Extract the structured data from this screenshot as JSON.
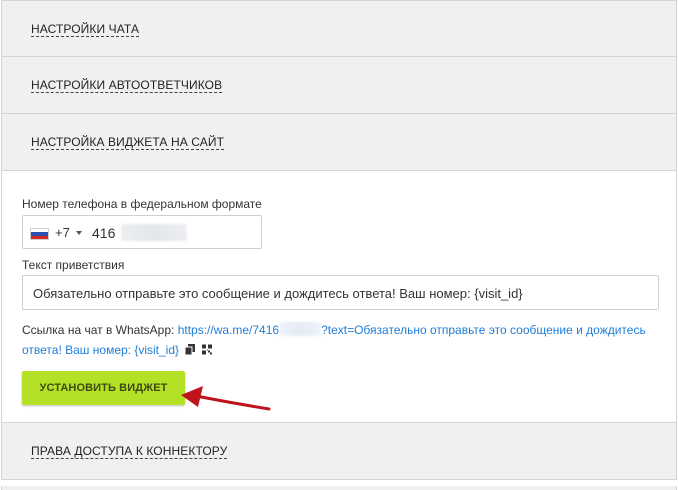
{
  "sections": {
    "chat_settings": "НАСТРОЙКИ ЧАТА",
    "autoresponder_settings": "НАСТРОЙКИ АВТООТВЕТЧИКОВ",
    "widget_settings": "НАСТРОЙКА ВИДЖЕТА НА САЙТ",
    "connector_access": "ПРАВА ДОСТУПА К КОННЕКТОРУ"
  },
  "widget": {
    "phone_label": "Номер телефона в федеральном формате",
    "country_code": "+7",
    "phone_value": "416",
    "greeting_label": "Текст приветствия",
    "greeting_value": "Обязательно отправьте это сообщение и дождитесь ответа! Ваш номер: {visit_id}",
    "link_label": "Ссылка на чат в WhatsApp:",
    "link_part1": "https://wa.me/7416",
    "link_part2": "?text=Обязательно отправьте это сообщение и дождитесь ответа! Ваш номер: {visit_id}",
    "install_button": "УСТАНОВИТЬ ВИДЖЕТ"
  },
  "colors": {
    "accent_button": "#b3e126",
    "link": "#1f7ed6",
    "arrow": "#c0141c"
  },
  "icons": [
    "flag-ru-icon",
    "dropdown-caret-icon",
    "copy-icon",
    "qr-code-icon",
    "arrow-pointer-icon"
  ]
}
